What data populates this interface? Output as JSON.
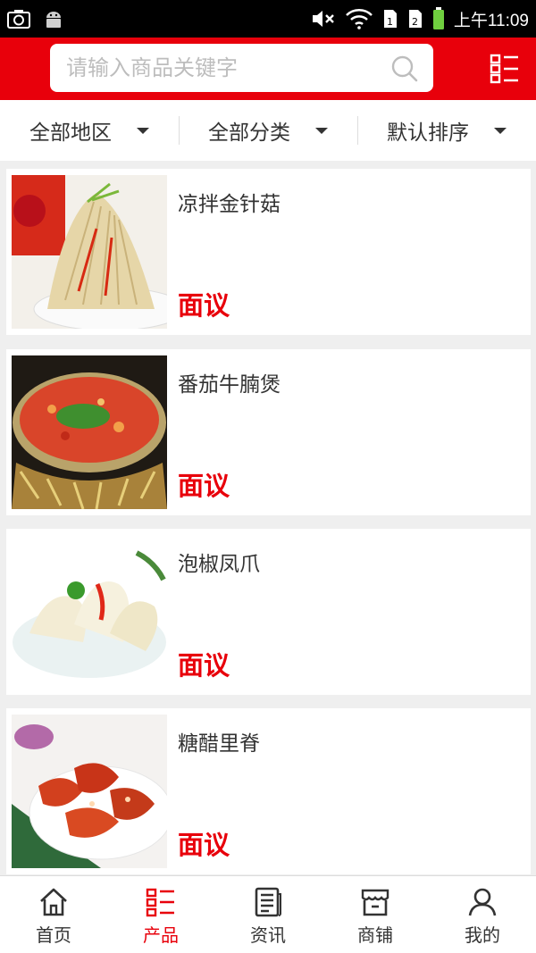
{
  "status_bar": {
    "time": "上午11:09",
    "icons": [
      "screenshot-icon",
      "android-icon",
      "mute-icon",
      "wifi-icon",
      "sim1-icon",
      "sim2-icon",
      "battery-icon"
    ]
  },
  "header": {
    "search_placeholder": "请输入商品关键字",
    "icons": [
      "search-icon",
      "category-menu-icon"
    ]
  },
  "filters": [
    {
      "label": "全部地区"
    },
    {
      "label": "全部分类"
    },
    {
      "label": "默认排序"
    }
  ],
  "products": [
    {
      "title": "凉拌金针菇",
      "price": "面议",
      "image": "enoki-salad"
    },
    {
      "title": "番茄牛腩煲",
      "price": "面议",
      "image": "tomato-beef-pot"
    },
    {
      "title": "泡椒凤爪",
      "price": "面议",
      "image": "pickled-chicken-feet"
    },
    {
      "title": "糖醋里脊",
      "price": "面议",
      "image": "sweet-sour-pork"
    }
  ],
  "tabs": [
    {
      "label": "首页",
      "icon": "home-icon",
      "active": false
    },
    {
      "label": "产品",
      "icon": "product-list-icon",
      "active": true
    },
    {
      "label": "资讯",
      "icon": "news-icon",
      "active": false
    },
    {
      "label": "商铺",
      "icon": "shop-icon",
      "active": false
    },
    {
      "label": "我的",
      "icon": "user-icon",
      "active": false
    }
  ],
  "colors": {
    "brand_red": "#e8000b",
    "background": "#efefef",
    "text": "#333333"
  }
}
